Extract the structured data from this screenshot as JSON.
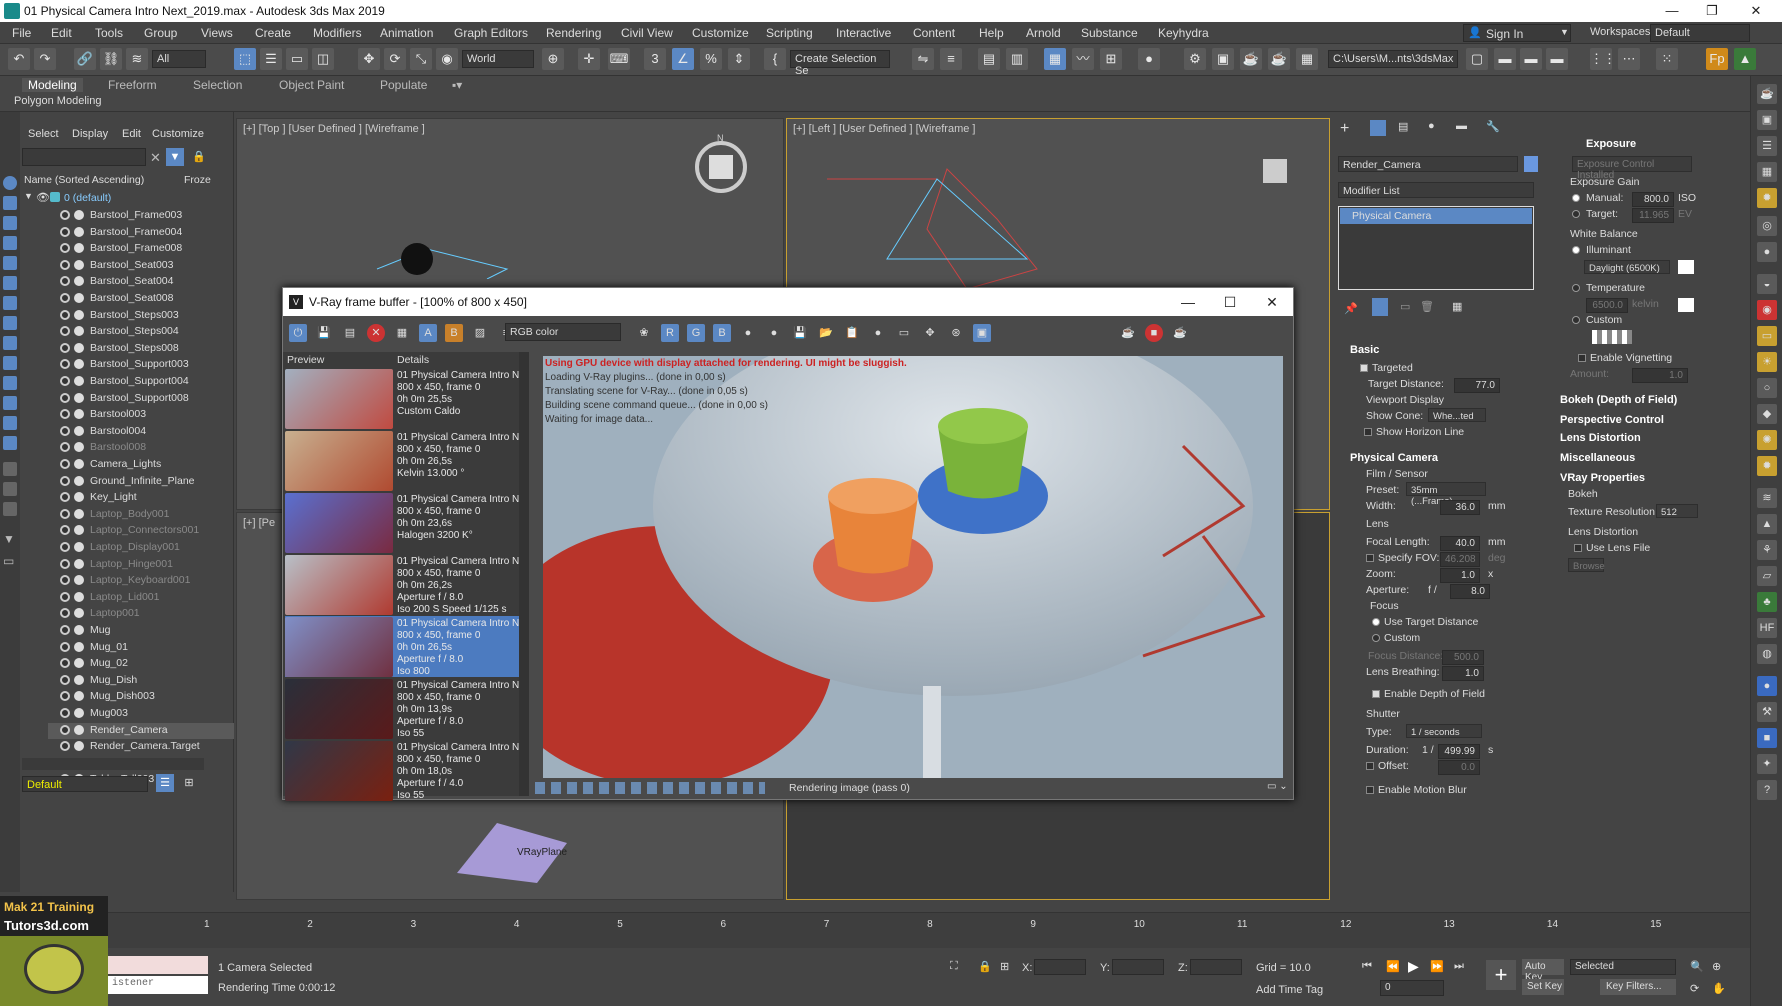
{
  "window": {
    "title": "01 Physical Camera Intro Next_2019.max - Autodesk 3ds Max 2019"
  },
  "menu": [
    "File",
    "Edit",
    "Tools",
    "Group",
    "Views",
    "Create",
    "Modifiers",
    "Animation",
    "Graph Editors",
    "Rendering",
    "Civil View",
    "Customize",
    "Scripting",
    "Interactive",
    "Content",
    "Help",
    "Arnold",
    "Substance",
    "Keyhydra"
  ],
  "account": {
    "sign_in": "Sign In",
    "workspaces_label": "Workspaces:",
    "workspace": "Default"
  },
  "toolbar": {
    "filter": "All",
    "coord": "World",
    "selection_set": "Create Selection Se",
    "path": "C:\\Users\\M...nts\\3dsMax"
  },
  "ribbon": {
    "tabs": [
      "Modeling",
      "Freeform",
      "Selection",
      "Object Paint",
      "Populate"
    ],
    "sub": "Polygon Modeling"
  },
  "scene_explorer": {
    "menu": [
      "Select",
      "Display",
      "Edit",
      "Customize"
    ],
    "column": "Name (Sorted Ascending)",
    "column2": "Froze",
    "root": "0 (default)",
    "items": [
      {
        "name": "Barstool_Frame003",
        "dim": false
      },
      {
        "name": "Barstool_Frame004",
        "dim": false
      },
      {
        "name": "Barstool_Frame008",
        "dim": false
      },
      {
        "name": "Barstool_Seat003",
        "dim": false
      },
      {
        "name": "Barstool_Seat004",
        "dim": false
      },
      {
        "name": "Barstool_Seat008",
        "dim": false
      },
      {
        "name": "Barstool_Steps003",
        "dim": false
      },
      {
        "name": "Barstool_Steps004",
        "dim": false
      },
      {
        "name": "Barstool_Steps008",
        "dim": false
      },
      {
        "name": "Barstool_Support003",
        "dim": false
      },
      {
        "name": "Barstool_Support004",
        "dim": false
      },
      {
        "name": "Barstool_Support008",
        "dim": false
      },
      {
        "name": "Barstool003",
        "dim": false
      },
      {
        "name": "Barstool004",
        "dim": false
      },
      {
        "name": "Barstool008",
        "dim": true
      },
      {
        "name": "Camera_Lights",
        "dim": false
      },
      {
        "name": "Ground_Infinite_Plane",
        "dim": false
      },
      {
        "name": "Key_Light",
        "dim": false
      },
      {
        "name": "Laptop_Body001",
        "dim": true
      },
      {
        "name": "Laptop_Connectors001",
        "dim": true
      },
      {
        "name": "Laptop_Display001",
        "dim": true
      },
      {
        "name": "Laptop_Hinge001",
        "dim": true
      },
      {
        "name": "Laptop_Keyboard001",
        "dim": true
      },
      {
        "name": "Laptop_Lid001",
        "dim": true
      },
      {
        "name": "Laptop001",
        "dim": true
      },
      {
        "name": "Mug",
        "dim": false
      },
      {
        "name": "Mug_01",
        "dim": false
      },
      {
        "name": "Mug_02",
        "dim": false
      },
      {
        "name": "Mug_Dish",
        "dim": false
      },
      {
        "name": "Mug_Dish003",
        "dim": false
      },
      {
        "name": "Mug003",
        "dim": false
      },
      {
        "name": "Render_Camera",
        "dim": false,
        "sel": true
      },
      {
        "name": "Render_Camera.Target",
        "dim": false
      },
      {
        "name": "Table_Stools",
        "dim": false
      },
      {
        "name": "Table_Tall003",
        "dim": false
      }
    ],
    "layer": "Default"
  },
  "viewports": {
    "top": "[+] [Top ] [User Defined ] [Wireframe ]",
    "left": "[+] [Left ] [User Defined ] [Wireframe ]",
    "persp": "[+] [Pe",
    "vrayplane": "VRayPlane"
  },
  "vfb": {
    "title": "V-Ray frame buffer - [100% of 800 x 450]",
    "channel": "RGB color",
    "history_headers": [
      "Preview",
      "Details"
    ],
    "history": [
      {
        "lines": [
          "01 Physical Camera Intro N",
          "800 x 450, frame 0",
          "0h 0m 25,5s",
          "Custom Caldo"
        ]
      },
      {
        "lines": [
          "01 Physical Camera Intro N",
          "800 x 450, frame 0",
          "0h 0m 26,5s",
          "Kelvin 13.000 °"
        ]
      },
      {
        "lines": [
          "01 Physical Camera Intro N",
          "800 x 450, frame 0",
          "0h 0m 23,6s",
          "Halogen 3200 K°"
        ]
      },
      {
        "lines": [
          "01 Physical Camera Intro N",
          "800 x 450, frame 0",
          "0h 0m 26,2s",
          "Aperture f / 8.0",
          "Iso 200 S Speed 1/125 s"
        ]
      },
      {
        "lines": [
          "01 Physical Camera Intro N",
          "800 x 450, frame 0",
          "0h 0m 26,5s",
          "Aperture f / 8.0",
          "Iso 800"
        ],
        "sel": true
      },
      {
        "lines": [
          "01 Physical Camera Intro N",
          "800 x 450, frame 0",
          "0h 0m 13,9s",
          "Aperture f / 8.0",
          "Iso 55"
        ]
      },
      {
        "lines": [
          "01 Physical Camera Intro N",
          "800 x 450, frame 0",
          "0h 0m 18,0s",
          "Aperture f / 4.0",
          "Iso 55"
        ]
      }
    ],
    "log": [
      "Using GPU device with display attached for rendering. UI might be sluggish.",
      "Loading V-Ray plugins... (done in 0,00 s)",
      "Translating scene for V-Ray... (done in 0,05 s)",
      "Building scene command queue... (done in 0,00 s)",
      "Waiting for image data..."
    ],
    "status": "Rendering image (pass 0)"
  },
  "command_panel": {
    "object_name": "Render_Camera",
    "modifier_list": "Modifier List",
    "stack_item": "Physical Camera",
    "basic": {
      "title": "Basic",
      "targeted": "Targeted",
      "target_distance_label": "Target Distance:",
      "target_distance": "77.0",
      "viewport_display": "Viewport Display",
      "show_cone_label": "Show Cone:",
      "show_cone": "Whe...ted",
      "show_horizon": "Show Horizon Line"
    },
    "physical": {
      "title": "Physical Camera",
      "film": "Film / Sensor",
      "preset_label": "Preset:",
      "preset": "35mm (...Frame)",
      "width_label": "Width:",
      "width": "36.0",
      "mm": "mm",
      "lens": "Lens",
      "focal_label": "Focal Length:",
      "focal": "40.0",
      "specify_fov": "Specify FOV:",
      "fov": "46.208",
      "deg": "deg",
      "zoom_label": "Zoom:",
      "zoom": "1.0",
      "x": "x",
      "aperture_label": "Aperture:",
      "f": "f /",
      "aperture": "8.0",
      "focus": "Focus",
      "use_target": "Use Target Distance",
      "custom": "Custom",
      "focus_distance_label": "Focus Distance:",
      "focus_distance": "500.0",
      "breathing_label": "Lens Breathing:",
      "breathing": "1.0",
      "enable_dof": "Enable Depth of Field",
      "shutter": "Shutter",
      "type_label": "Type:",
      "type": "1 / seconds",
      "duration_label": "Duration:",
      "duration": "499.99",
      "s": "s",
      "offset_label": "Offset:",
      "offset": "0.0",
      "motion_blur": "Enable Motion Blur"
    },
    "exposure": {
      "title": "Exposure",
      "installed": "Exposure Control Installed",
      "gain": "Exposure Gain",
      "manual": "Manual:",
      "manual_val": "800.0",
      "iso": "ISO",
      "target": "Target:",
      "target_val": "11.965",
      "ev": "EV",
      "white_balance": "White Balance",
      "illuminant": "Illuminant",
      "daylight": "Daylight (6500K)",
      "temperature": "Temperature",
      "temp_val": "6500.0",
      "kelvin": "kelvin",
      "custom": "Custom",
      "vignetting": "Enable Vignetting",
      "amount": "Amount:",
      "amount_val": "1.0"
    },
    "rollouts": [
      "Bokeh (Depth of Field)",
      "Perspective Control",
      "Lens Distortion",
      "Miscellaneous",
      "VRay Properties"
    ],
    "vray": {
      "bokeh": "Bokeh",
      "texture_res_label": "Texture Resolution",
      "texture_res": "512",
      "lens_distortion": "Lens Distortion",
      "use_lens_file": "Use Lens File",
      "browse": "Browse"
    }
  },
  "timeline": {
    "ticks": [
      "1",
      "2",
      "3",
      "4",
      "5",
      "6",
      "7",
      "8",
      "9",
      "10",
      "11",
      "12",
      "13",
      "14",
      "15"
    ]
  },
  "status": {
    "selected": "1 Camera Selected",
    "render_time": "Rendering Time 0:00:12",
    "x": "X:",
    "y": "Y:",
    "z": "Z:",
    "grid": "Grid = 10.0",
    "add_time_tag": "Add Time Tag",
    "auto_key": "Auto Key",
    "set_key": "Set Key",
    "selected_dd": "Selected",
    "key_filters": "Key Filters...",
    "frame": "0",
    "listener": "istener"
  },
  "brand": {
    "line1": "Mak 21 Training",
    "line2": "Tutors3d.com"
  }
}
